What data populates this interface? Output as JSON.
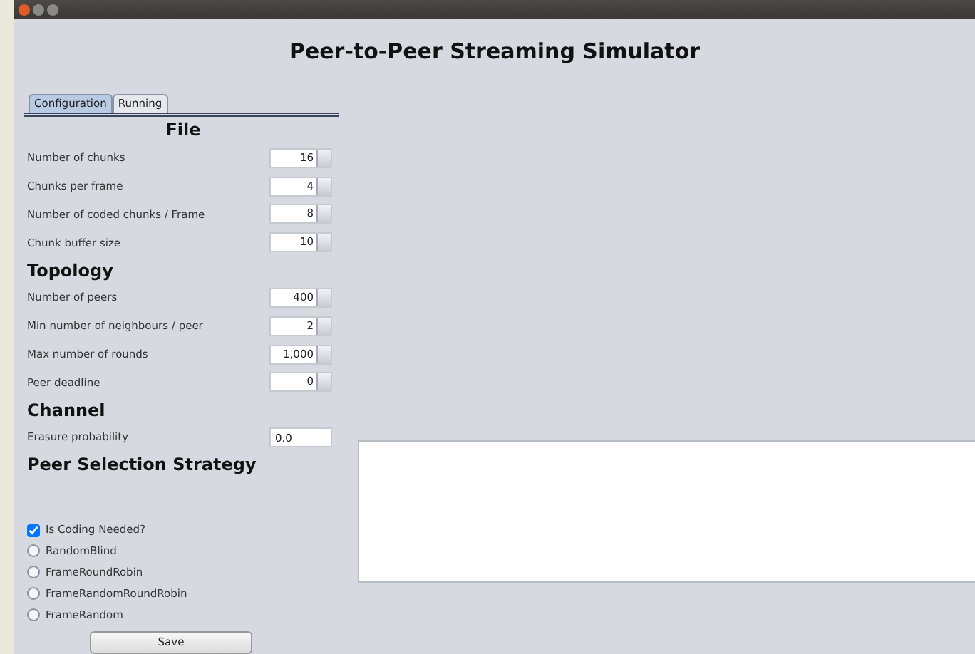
{
  "window": {
    "title": "Peer-to-Peer Streaming Simulator"
  },
  "tabs": [
    {
      "label": "Configuration",
      "selected": true
    },
    {
      "label": "Running",
      "selected": false
    }
  ],
  "sections": [
    {
      "heading": "File",
      "kind": "centered",
      "fields": [
        {
          "kind": "spinner",
          "label": "Number of chunks",
          "value": "16"
        },
        {
          "kind": "spinner",
          "label": "Chunks per frame",
          "value": "4"
        },
        {
          "kind": "spinner",
          "label": "Number of coded chunks / Frame",
          "value": "8"
        },
        {
          "kind": "spinner",
          "label": "Chunk buffer size",
          "value": "10"
        }
      ]
    },
    {
      "heading": "Topology",
      "kind": "plain",
      "fields": [
        {
          "kind": "spinner",
          "label": "Number of peers",
          "value": "400"
        },
        {
          "kind": "spinner",
          "label": "Min number of neighbours / peer",
          "value": "2"
        },
        {
          "kind": "spinner",
          "label": "Max number of rounds",
          "value": "1,000"
        },
        {
          "kind": "spinner",
          "label": "Peer deadline",
          "value": "0"
        }
      ]
    },
    {
      "heading": "Channel",
      "kind": "plain",
      "fields": [
        {
          "kind": "text",
          "label": "Erasure probability",
          "value": "0.0"
        }
      ]
    },
    {
      "heading": "Peer Selection Strategy",
      "kind": "plain"
    }
  ],
  "coding_checkbox": {
    "label": "Is Coding Needed?",
    "checked": true
  },
  "strategies": [
    {
      "label": "RandomBlind",
      "selected": false
    },
    {
      "label": "FrameRoundRobin",
      "selected": false
    },
    {
      "label": "FrameRandomRoundRobin",
      "selected": false
    },
    {
      "label": "FrameRandom",
      "selected": false
    }
  ],
  "save_button": "Save"
}
